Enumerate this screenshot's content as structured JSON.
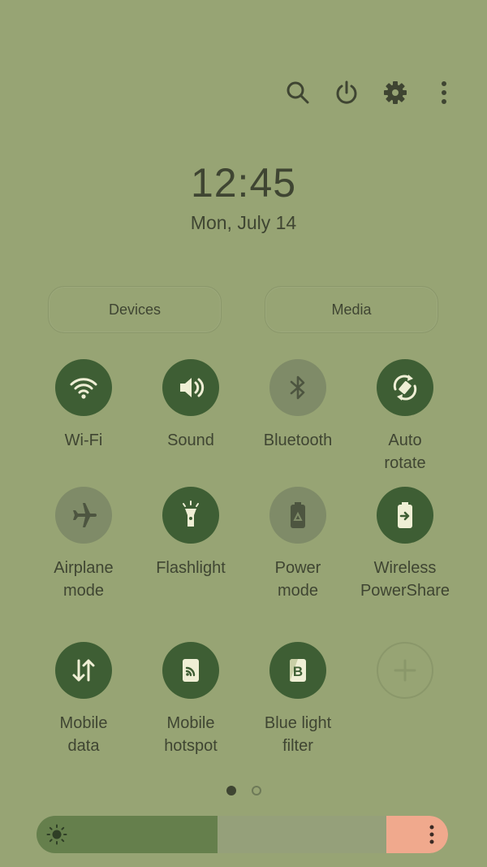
{
  "top_icons": [
    "search-icon",
    "power-icon",
    "gear-icon",
    "more-vert-icon"
  ],
  "clock": {
    "time": "12:45",
    "date": "Mon, July 14"
  },
  "pills": {
    "devices": "Devices",
    "media": "Media"
  },
  "tiles": [
    {
      "label": "Wi-Fi",
      "icon": "wifi-icon",
      "state": "on"
    },
    {
      "label": "Sound",
      "icon": "volume-icon",
      "state": "on"
    },
    {
      "label": "Bluetooth",
      "icon": "bluetooth-icon",
      "state": "off"
    },
    {
      "label": "Auto\nrotate",
      "icon": "auto-rotate-icon",
      "state": "on"
    },
    {
      "label": "Airplane\nmode",
      "icon": "airplane-icon",
      "state": "off"
    },
    {
      "label": "Flashlight",
      "icon": "flashlight-icon",
      "state": "on"
    },
    {
      "label": "Power\nmode",
      "icon": "battery-recycle-icon",
      "state": "off"
    },
    {
      "label": "Wireless\nPowerShare",
      "icon": "battery-share-icon",
      "state": "on"
    },
    {
      "label": "Mobile\ndata",
      "icon": "data-arrows-icon",
      "state": "on"
    },
    {
      "label": "Mobile\nhotspot",
      "icon": "hotspot-icon",
      "state": "on"
    },
    {
      "label": "Blue light\nfilter",
      "icon": "blue-light-icon",
      "state": "on"
    },
    {
      "label": "",
      "icon": "add-icon",
      "state": "add"
    }
  ],
  "pages": {
    "count": 2,
    "current": 1
  },
  "brightness": {
    "level": 0.44,
    "icon": "sun-icon"
  },
  "colors": {
    "background": "#97a474",
    "tile_on": "#3e5e34",
    "tile_off": "#7f8b68",
    "text": "#3f4532",
    "brightness_fill": "#657f4c",
    "brightness_end": "#f0a98d"
  }
}
